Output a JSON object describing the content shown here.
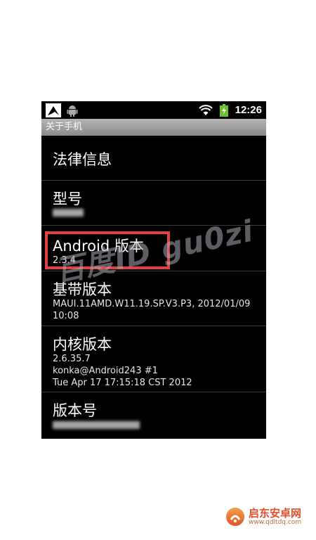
{
  "status_bar": {
    "time": "12:26"
  },
  "title_bar": {
    "title": "关于手机"
  },
  "items": [
    {
      "title": "法律信息",
      "subtitle": []
    },
    {
      "title": "型号",
      "subtitle": []
    },
    {
      "title": "Android 版本",
      "subtitle": [
        "2.3.4"
      ]
    },
    {
      "title": "基带版本",
      "subtitle": [
        "MAUI.11AMD.W11.19.SP.V3.P3, 2012/01/09",
        "10:08"
      ]
    },
    {
      "title": "内核版本",
      "subtitle": [
        "2.6.35.7",
        "konka@Android243 #1",
        "Tue Apr 17 17:15:18 CST 2012"
      ]
    },
    {
      "title": "版本号",
      "subtitle": []
    }
  ],
  "watermark": {
    "text": "百度ID gu0zi"
  },
  "site_logo": {
    "name": "启东安卓网",
    "url": "www.qdltdq.com"
  },
  "colors": {
    "highlight": "#e34040",
    "background": "#000000",
    "title_bar": "#a0a0a0"
  }
}
